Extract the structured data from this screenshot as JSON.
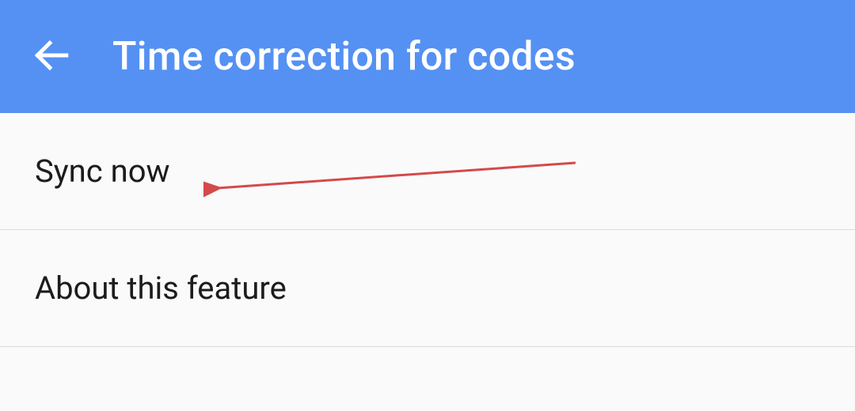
{
  "header": {
    "title": "Time correction for codes"
  },
  "list": {
    "items": [
      {
        "label": "Sync now"
      },
      {
        "label": "About this feature"
      }
    ]
  },
  "colors": {
    "header_bg": "#5591f3",
    "page_bg": "#fafafa",
    "text": "#1c1c1c",
    "divider": "#dcdcdc",
    "arrow": "#d44a4a"
  }
}
